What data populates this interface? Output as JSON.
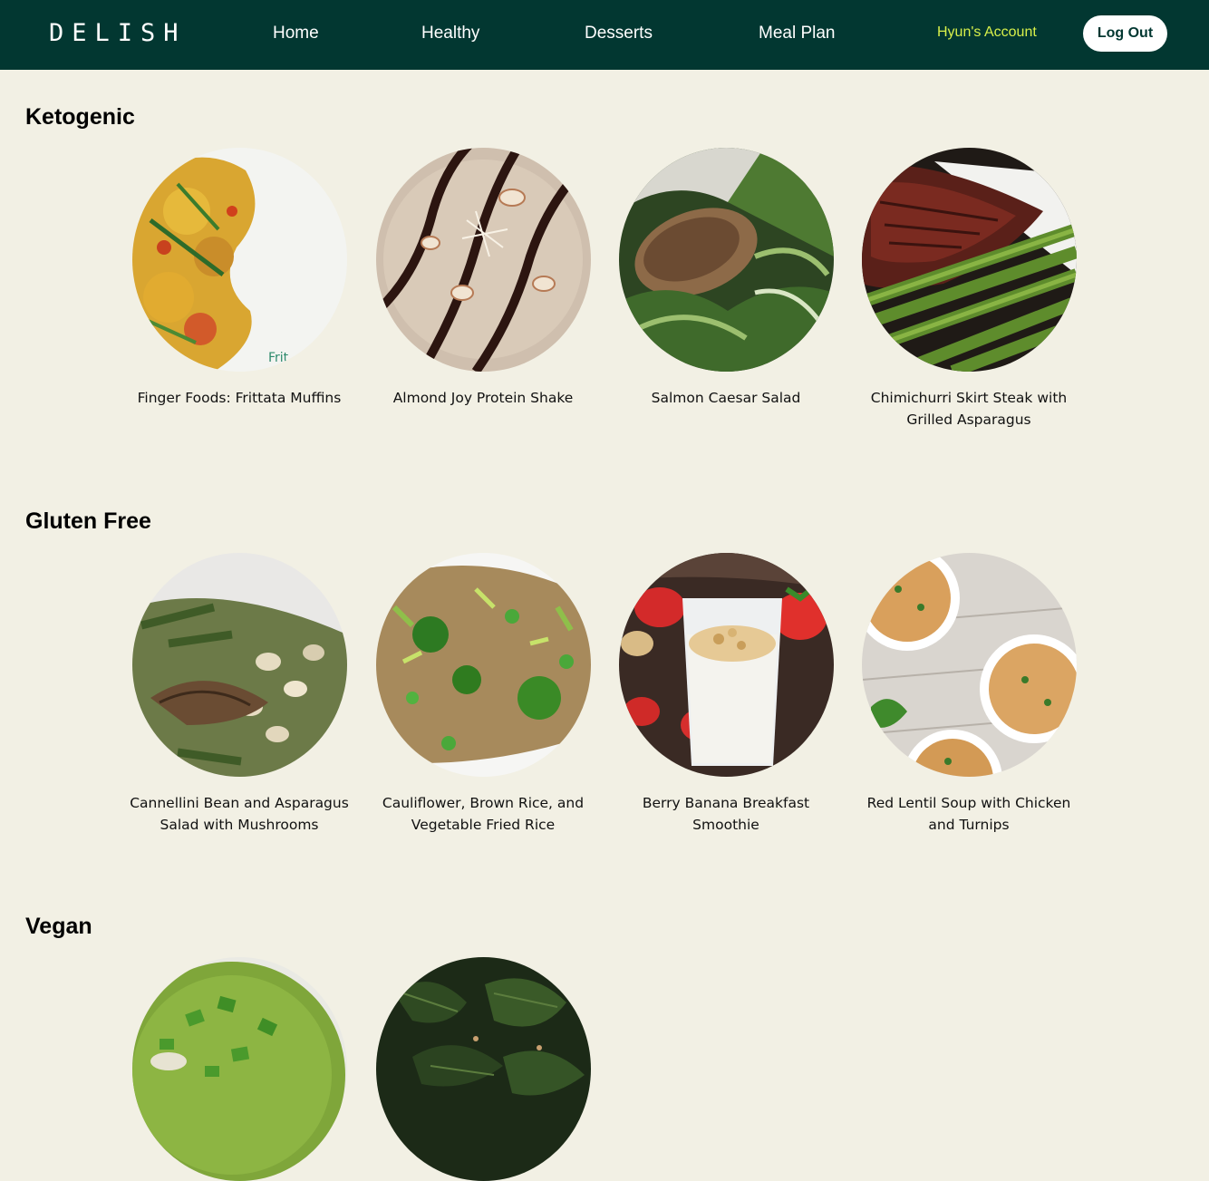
{
  "nav": {
    "logo": "DELISH",
    "links": [
      "Home",
      "Healthy",
      "Desserts",
      "Meal Plan"
    ],
    "account": "Hyun's Account",
    "logout": "Log Out"
  },
  "colors": {
    "navbar_bg": "#023731",
    "page_bg": "#f2f0e4",
    "account_link": "#d8f04a"
  },
  "sections": [
    {
      "title": "Ketogenic",
      "recipes": [
        {
          "title": "Finger Foods: Frittata Muffins",
          "image": "frittata-muffins-photo"
        },
        {
          "title": "Almond Joy Protein Shake",
          "image": "almond-joy-shake-photo"
        },
        {
          "title": "Salmon Caesar Salad",
          "image": "salmon-caesar-salad-photo"
        },
        {
          "title": "Chimichurri Skirt Steak with Grilled Asparagus",
          "image": "skirt-steak-asparagus-photo"
        }
      ]
    },
    {
      "title": "Gluten Free",
      "recipes": [
        {
          "title": "Cannellini Bean and Asparagus Salad with Mushrooms",
          "image": "bean-asparagus-salad-photo"
        },
        {
          "title": "Cauliflower, Brown Rice, and Vegetable Fried Rice",
          "image": "cauliflower-fried-rice-photo"
        },
        {
          "title": "Berry Banana Breakfast Smoothie",
          "image": "berry-banana-smoothie-photo"
        },
        {
          "title": "Red Lentil Soup with Chicken and Turnips",
          "image": "red-lentil-soup-photo"
        }
      ]
    },
    {
      "title": "Vegan",
      "recipes": [
        {
          "title": "",
          "image": "green-soup-photo"
        },
        {
          "title": "",
          "image": "sauteed-greens-photo"
        }
      ]
    }
  ]
}
